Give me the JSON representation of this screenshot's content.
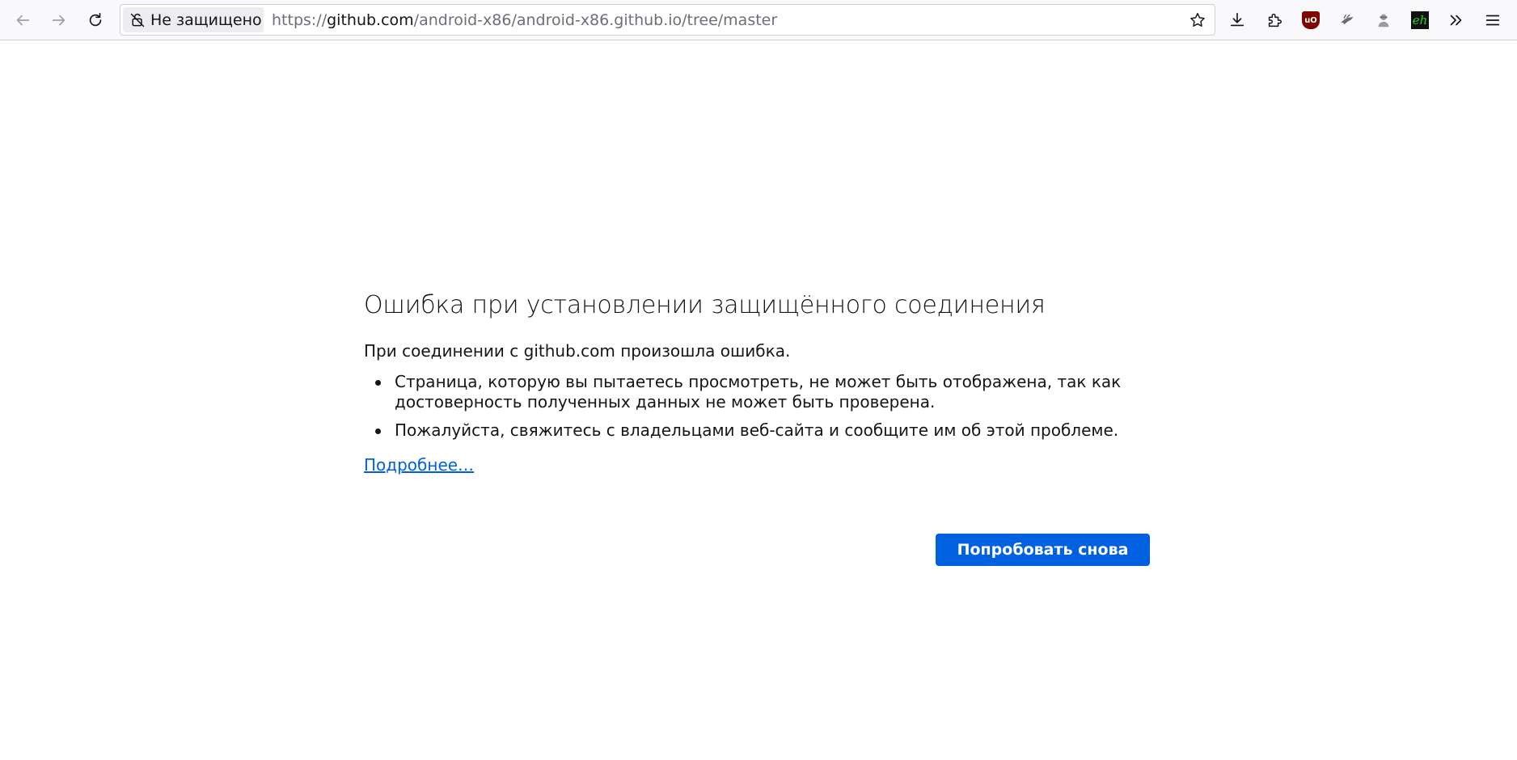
{
  "toolbar": {
    "back_icon": "arrow-left-icon",
    "forward_icon": "arrow-right-icon",
    "reload_icon": "reload-icon",
    "identity_label": "Не защищено",
    "url": {
      "scheme": "https://",
      "host": "github.com",
      "path": "/android-x86/android-x86.github.io/tree/master"
    },
    "bookmark_icon": "star-icon",
    "downloads_icon": "download-icon",
    "extensions_icon": "puzzle-icon",
    "ublock_label": "uO",
    "eh_label": "eh",
    "overflow_icon": "chevron-double-right-icon",
    "menu_icon": "hamburger-menu-icon"
  },
  "error": {
    "title": "Ошибка при установлении защищённого соединения",
    "intro": "При соединении с github.com произошла ошибка.",
    "reasons": [
      "Страница, которую вы пытаетесь просмотреть, не может быть отображена, так как достоверность полученных данных не может быть проверена.",
      "Пожалуйста, свяжитесь с владельцами веб-сайта и сообщите им об этой проблеме."
    ],
    "learn_more": "Подробнее…",
    "retry_button": "Попробовать снова"
  },
  "colors": {
    "accent": "#0061e0",
    "toolbar_bg": "#f9f9fb",
    "text": "#15141a"
  }
}
